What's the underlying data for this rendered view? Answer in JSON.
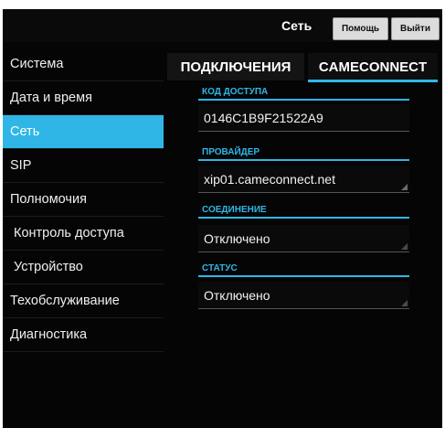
{
  "header": {
    "title": "Сеть",
    "help_label": "Помощь",
    "exit_label": "Выйти"
  },
  "sidebar": {
    "items": [
      {
        "label": "Система"
      },
      {
        "label": "Дата и время"
      },
      {
        "label": "Сеть"
      },
      {
        "label": "SIP"
      },
      {
        "label": "Полномочия"
      },
      {
        "label": "Контроль доступа"
      },
      {
        "label": "Устройство"
      },
      {
        "label": "Техобслуживание"
      },
      {
        "label": "Диагностика"
      }
    ],
    "active": "Сеть"
  },
  "tabs": [
    {
      "label": "ПОДКЛЮЧЕНИЯ"
    },
    {
      "label": "CAMECONNECT"
    }
  ],
  "form": {
    "access_code": {
      "label": "КОД ДОСТУПА",
      "value": "0146C1B9F21522A9"
    },
    "provider": {
      "label": "ПРОВАЙДЕР",
      "value": "xip01.cameconnect.net"
    },
    "connection": {
      "label": "СОЕДИНЕНИЕ",
      "value": "Отключено"
    },
    "status": {
      "label": "СТАТУС",
      "value": "Отключено"
    }
  },
  "colors": {
    "accent": "#2fb6e6",
    "background": "#050505"
  }
}
